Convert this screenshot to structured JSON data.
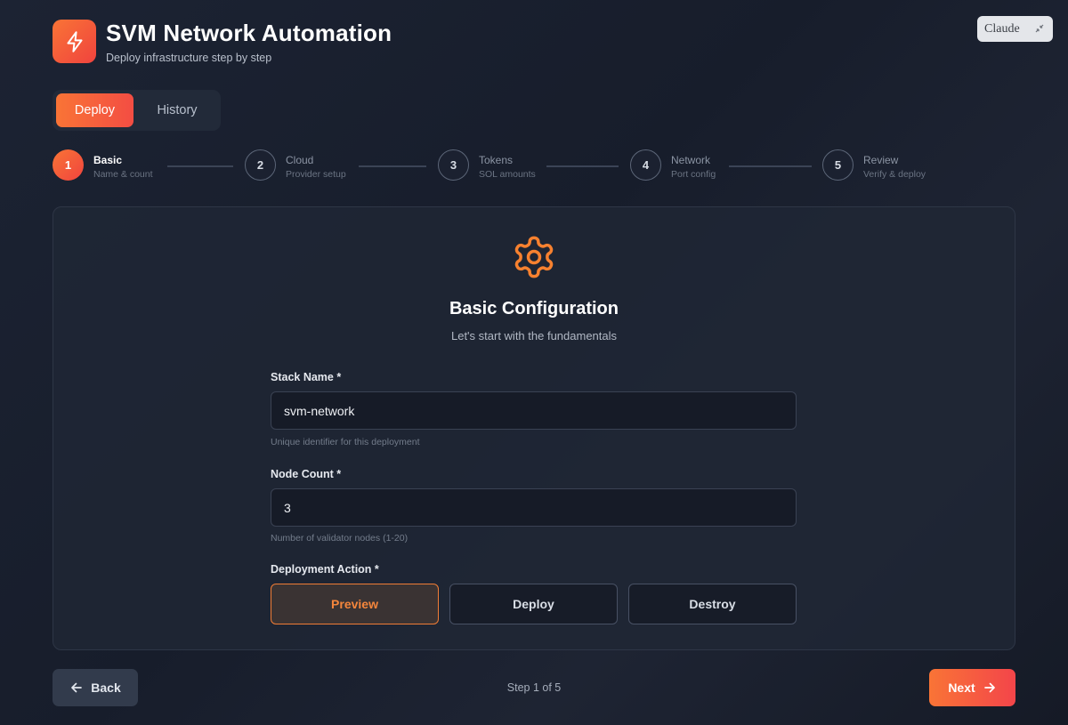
{
  "header": {
    "title": "SVM Network Automation",
    "subtitle": "Deploy infrastructure step by step",
    "logo_icon": "lightning-bolt-icon",
    "accent_start": "#f97436",
    "accent_end": "#f0433e"
  },
  "assistant_badge": {
    "label": "Claude",
    "icon": "collapse-arrows-icon"
  },
  "tabs": [
    {
      "label": "Deploy",
      "active": true
    },
    {
      "label": "History",
      "active": false
    }
  ],
  "steps": [
    {
      "number": "1",
      "title": "Basic",
      "subtitle": "Name & count",
      "active": true
    },
    {
      "number": "2",
      "title": "Cloud",
      "subtitle": "Provider setup",
      "active": false
    },
    {
      "number": "3",
      "title": "Tokens",
      "subtitle": "SOL amounts",
      "active": false
    },
    {
      "number": "4",
      "title": "Network",
      "subtitle": "Port config",
      "active": false
    },
    {
      "number": "5",
      "title": "Review",
      "subtitle": "Verify & deploy",
      "active": false
    }
  ],
  "card": {
    "icon": "gear-icon",
    "title": "Basic Configuration",
    "subtitle": "Let's start with the fundamentals",
    "fields": {
      "stack_name": {
        "label": "Stack Name *",
        "value": "svm-network",
        "help": "Unique identifier for this deployment"
      },
      "node_count": {
        "label": "Node Count *",
        "value": "3",
        "help": "Number of validator nodes (1-20)"
      },
      "deployment_action": {
        "label": "Deployment Action *",
        "options": [
          "Preview",
          "Deploy",
          "Destroy"
        ],
        "selected": "Preview"
      }
    }
  },
  "footer": {
    "back_label": "Back",
    "step_indicator": "Step 1 of 5",
    "next_label": "Next"
  }
}
